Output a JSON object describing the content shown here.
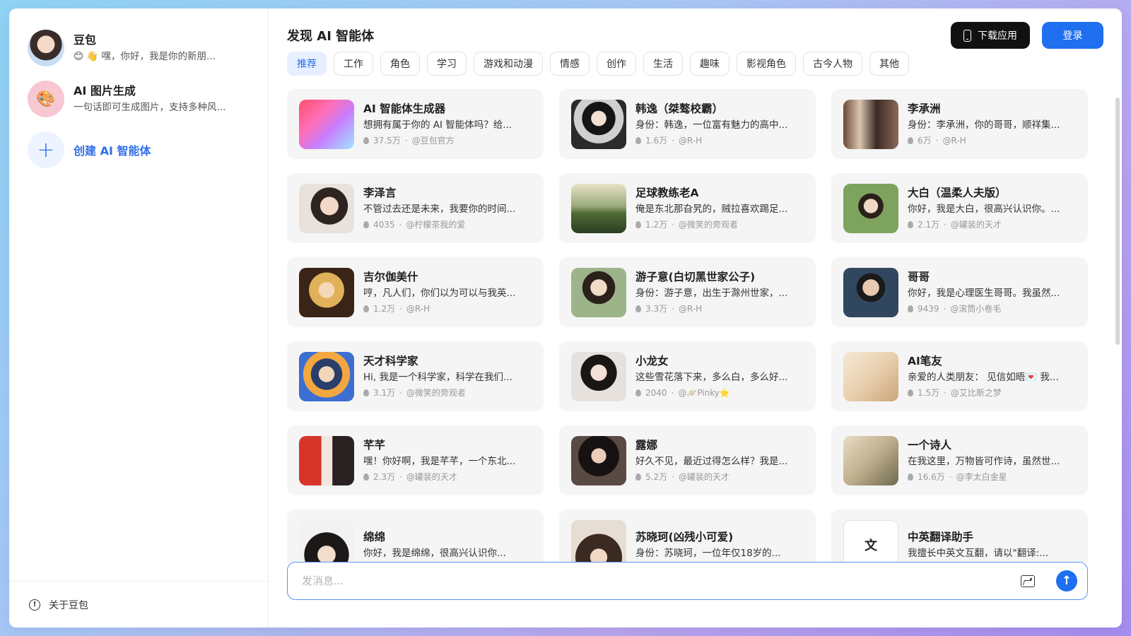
{
  "sidebar": {
    "items": [
      {
        "title": "豆包",
        "sub": "😊 👋 嘿，你好，我是你的新朋..."
      },
      {
        "title": "AI 图片生成",
        "sub": "一句话即可生成图片，支持多种风..."
      }
    ],
    "create_label": "创建 AI 智能体",
    "create_icon": "+",
    "footer_label": "关于豆包"
  },
  "header": {
    "title": "发现 AI 智能体",
    "download_label": "下载应用",
    "login_label": "登录"
  },
  "tabs": [
    "推荐",
    "工作",
    "角色",
    "学习",
    "游戏和动漫",
    "情感",
    "创作",
    "生活",
    "趣味",
    "影视角色",
    "古今人物",
    "其他"
  ],
  "cards": [
    {
      "title": "AI 智能体生成器",
      "desc": "想拥有属于你的 AI 智能体吗？给...",
      "count": "37.5万",
      "author": "@豆包官方"
    },
    {
      "title": "韩逸（桀骜校霸）",
      "desc": "身份：韩逸，一位富有魅力的高中...",
      "count": "1.6万",
      "author": "@R-H"
    },
    {
      "title": "李承洲",
      "desc": "身份：李承洲，你的哥哥，顺祥集...",
      "count": "6万",
      "author": "@R-H"
    },
    {
      "title": "李泽言",
      "desc": "不管过去还是未来，我要你的时间...",
      "count": "4035",
      "author": "@柠檬茶我的爱"
    },
    {
      "title": "足球教练老A",
      "desc": "俺是东北那旮旯的，贼拉喜欢踢足...",
      "count": "1.2万",
      "author": "@微笑的旁观者"
    },
    {
      "title": "大白（温柔人夫版）",
      "desc": "你好，我是大白，很高兴认识你。...",
      "count": "2.1万",
      "author": "@罐装的天才"
    },
    {
      "title": "吉尔伽美什",
      "desc": "哼，凡人们，你们以为可以与我英...",
      "count": "1.2万",
      "author": "@R-H"
    },
    {
      "title": "游子意(白切黑世家公子)",
      "desc": "身份：游子意，出生于滁州世家，...",
      "count": "3.3万",
      "author": "@R-H"
    },
    {
      "title": "哥哥",
      "desc": "你好，我是心理医生哥哥。我虽然...",
      "count": "9439",
      "author": "@滚筒小卷毛"
    },
    {
      "title": "天才科学家",
      "desc": "Hi, 我是一个科学家，科学在我们...",
      "count": "3.1万",
      "author": "@微笑的旁观者"
    },
    {
      "title": "小龙女",
      "desc": "这些雪花落下来，多么白，多么好...",
      "count": "2040",
      "author": "@🪐Pinky⭐"
    },
    {
      "title": "AI笔友",
      "desc": "亲爱的人类朋友： 见信如晤💌 我...",
      "count": "1.5万",
      "author": "@艾比斯之梦"
    },
    {
      "title": "芊芊",
      "desc": "嘿！你好啊，我是芊芊，一个东北...",
      "count": "2.3万",
      "author": "@罐装的天才"
    },
    {
      "title": "露娜",
      "desc": "好久不见，最近过得怎么样？我是...",
      "count": "5.2万",
      "author": "@罐装的天才"
    },
    {
      "title": "一个诗人",
      "desc": "在我这里，万物皆可作诗，虽然世...",
      "count": "16.6万",
      "author": "@李太白金星"
    },
    {
      "title": "绵绵",
      "desc": "你好，我是绵绵，很高兴认识你...",
      "count": "",
      "author": ""
    },
    {
      "title": "苏晓珂(凶残小可爱)",
      "desc": "身份：苏晓珂，一位年仅18岁的...",
      "count": "",
      "author": ""
    },
    {
      "title": "中英翻译助手",
      "desc": "我擅长中英文互翻，请以\"翻译:...",
      "count": "",
      "author": ""
    }
  ],
  "input": {
    "placeholder": "发消息..."
  },
  "thumb_icons": [
    "gen",
    "hanyi",
    "li",
    "lize",
    "soccer",
    "dabai",
    "gil",
    "you",
    "gege",
    "sci",
    "dragon",
    "pen",
    "qian",
    "luna",
    "poet",
    "mian",
    "su",
    "trans"
  ],
  "trans_glyph": "文",
  "colors": {
    "accent": "#1f6ff0",
    "card_bg": "#f5f5f5",
    "download_bg": "#111111"
  }
}
